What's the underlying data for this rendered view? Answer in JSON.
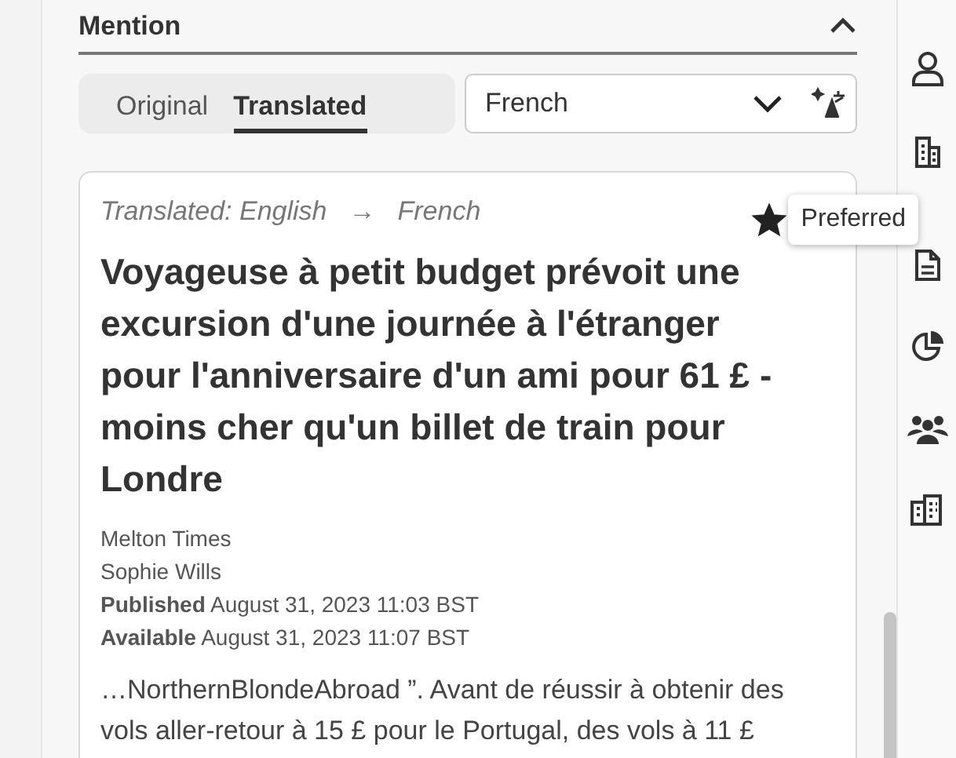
{
  "section": {
    "title": "Mention",
    "expanded": true
  },
  "tabs": [
    {
      "label": "Original",
      "selected": false
    },
    {
      "label": "Translated",
      "selected": true
    }
  ],
  "language_select": {
    "value": "French"
  },
  "article": {
    "translation_from": "Translated: English",
    "arrow": "→",
    "translation_to": "French",
    "preferred": true,
    "tooltip": "Preferred",
    "headline": "Voyageuse à petit budget prévoit une excursion d'une journée à l'étranger pour l'anniversaire d'un ami pour 61 £ - moins cher qu'un billet de train pour Londre",
    "source": "Melton Times",
    "author": "Sophie Wills",
    "dates": [
      {
        "label": "Published",
        "value": "August 31, 2023 11:03 BST"
      },
      {
        "label": "Available",
        "value": "August 31, 2023 11:07 BST"
      }
    ],
    "excerpt": "…NorthernBlondeAbroad ”. Avant de réussir à obtenir des vols aller-retour à 15 £ pour le Portugal, des vols à 11 £"
  }
}
